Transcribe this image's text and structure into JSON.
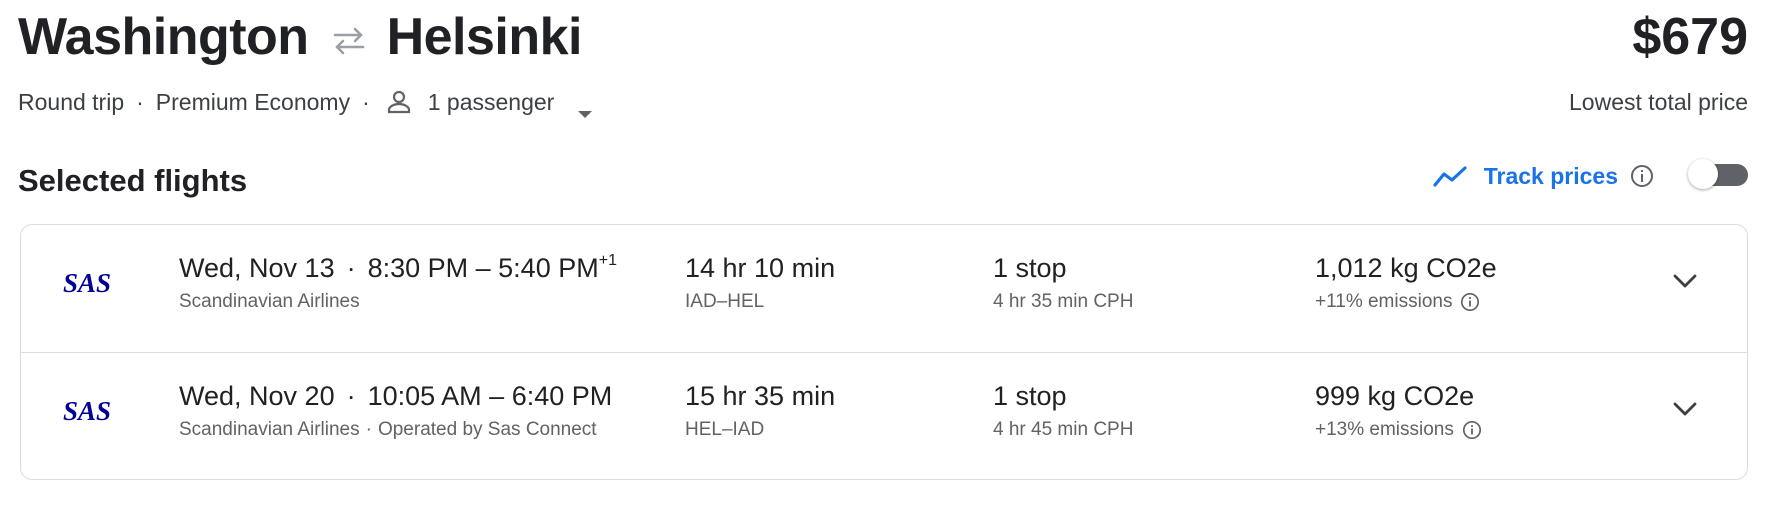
{
  "header": {
    "origin": "Washington",
    "destination": "Helsinki",
    "swap_icon": "swap-arrows-icon",
    "price": "$679",
    "price_label": "Lowest total price"
  },
  "trip": {
    "type": "Round trip",
    "cabin": "Premium Economy",
    "passengers": "1 passenger",
    "separator": "·"
  },
  "section": {
    "title": "Selected flights"
  },
  "track": {
    "label": "Track prices",
    "enabled": false,
    "accent_color": "#1a73e8"
  },
  "flights": [
    {
      "airline_logo": "SAS",
      "date": "Wed, Nov 13",
      "time_range": "8:30 PM – 5:40 PM",
      "day_offset": "+1",
      "airline": "Scandinavian Airlines",
      "operated_by": "",
      "duration": "14 hr 10 min",
      "airports": "IAD–HEL",
      "stops": "1 stop",
      "layover": "4 hr 35 min CPH",
      "co2": "1,012 kg CO2e",
      "emissions": "+11% emissions"
    },
    {
      "airline_logo": "SAS",
      "date": "Wed, Nov 20",
      "time_range": "10:05 AM – 6:40 PM",
      "day_offset": "",
      "airline": "Scandinavian Airlines",
      "operated_by": "Operated by Sas Connect",
      "duration": "15 hr 35 min",
      "airports": "HEL–IAD",
      "stops": "1 stop",
      "layover": "4 hr 45 min CPH",
      "co2": "999 kg CO2e",
      "emissions": "+13% emissions"
    }
  ],
  "colors": {
    "sas_blue": "#000099",
    "text": "#202124",
    "secondary": "#5f6368",
    "border": "#dadce0"
  }
}
